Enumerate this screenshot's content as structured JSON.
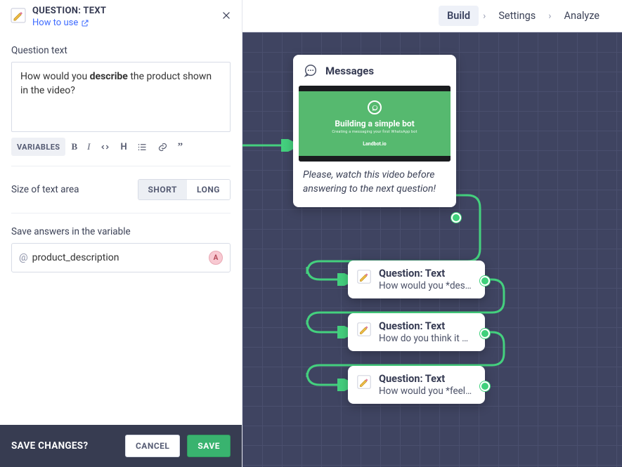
{
  "panel": {
    "title": "QUESTION: TEXT",
    "how_to_use": "How to use",
    "question_label": "Question text",
    "question_text_pre": "How would you ",
    "question_text_bold": "describe",
    "question_text_post": " the product shown in the video?",
    "toolbar": {
      "variables": "VARIABLES"
    },
    "size_label": "Size of text area",
    "size_short": "SHORT",
    "size_long": "LONG",
    "save_var_label": "Save answers in the variable",
    "var_at": "@",
    "var_name": "product_description",
    "var_chip": "A"
  },
  "footer": {
    "ask": "SAVE CHANGES?",
    "cancel": "CANCEL",
    "save": "SAVE"
  },
  "nav": {
    "build": "Build",
    "settings": "Settings",
    "analyze": "Analyze",
    "sep": "›"
  },
  "canvas": {
    "messages_title": "Messages",
    "video_title": "Building a simple bot",
    "video_sub": "Creating a messaging your first WhatsApp bot",
    "video_brand": "Landbot.io",
    "messages_text": "Please, watch this video before answering to the next question!",
    "q1_title": "Question: Text",
    "q1_desc": "How would you *des…",
    "q2_title": "Question: Text",
    "q2_desc": "How do you think it …",
    "q3_title": "Question: Text",
    "q3_desc": "How would you *feel…"
  }
}
